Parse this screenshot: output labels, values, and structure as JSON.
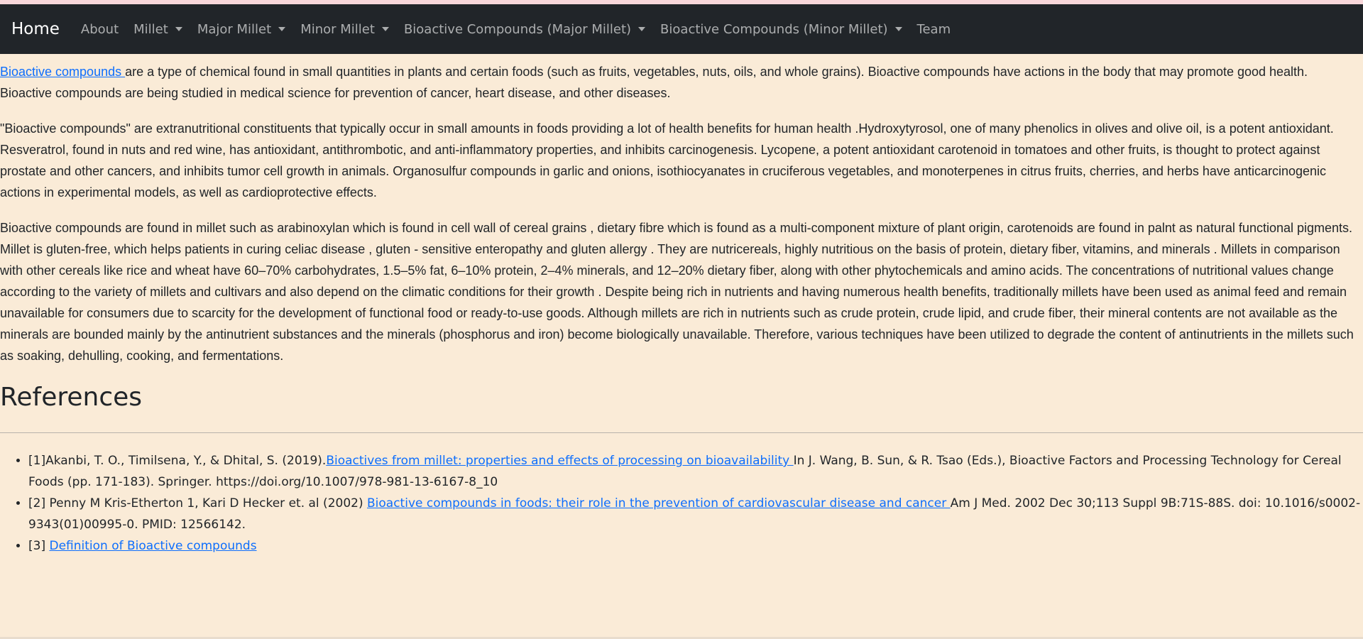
{
  "navbar": {
    "brand": "Home",
    "items": [
      {
        "label": "About",
        "dropdown": false
      },
      {
        "label": "Millet",
        "dropdown": true
      },
      {
        "label": "Major Millet",
        "dropdown": true
      },
      {
        "label": "Minor Millet",
        "dropdown": true
      },
      {
        "label": "Bioactive Compounds (Major Millet)",
        "dropdown": true
      },
      {
        "label": "Bioactive Compounds (Minor Millet)",
        "dropdown": true
      },
      {
        "label": "Team",
        "dropdown": false
      }
    ]
  },
  "content": {
    "p1_link": "Bioactive compounds ",
    "p1_text": "are a type of chemical found in small quantities in plants and certain foods (such as fruits, vegetables, nuts, oils, and whole grains). Bioactive compounds have actions in the body that may promote good health. Bioactive compounds are being studied in medical science for prevention of cancer, heart disease, and other diseases.",
    "p2_text": "\"Bioactive compounds\" are extranutritional constituents that typically occur in small amounts in foods providing a lot of health benefits for human health .Hydroxytyrosol, one of many phenolics in olives and olive oil, is a potent antioxidant. Resveratrol, found in nuts and red wine, has antioxidant, antithrombotic, and anti-inflammatory properties, and inhibits carcinogenesis. Lycopene, a potent antioxidant carotenoid in tomatoes and other fruits, is thought to protect against prostate and other cancers, and inhibits tumor cell growth in animals. Organosulfur compounds in garlic and onions, isothiocyanates in cruciferous vegetables, and monoterpenes in citrus fruits, cherries, and herbs have anticarcinogenic actions in experimental models, as well as cardioprotective effects.",
    "p3_text": "Bioactive compounds are found in millet such as arabinoxylan which is found in cell wall of cereal grains , dietary fibre which is found as a multi-component mixture of plant origin, carotenoids are found in palnt as natural functional pigments. Millet is gluten-free, which helps patients in curing celiac disease , gluten - sensitive enteropathy and gluten allergy . They are nutricereals, highly nutritious on the basis of protein, dietary fiber, vitamins, and minerals . Millets in comparison with other cereals like rice and wheat have 60–70% carbohydrates, 1.5–5% fat, 6–10% protein, 2–4% minerals, and 12–20% dietary fiber, along with other phytochemicals and amino acids. The concentrations of nutritional values change according to the variety of millets and cultivars and also depend on the climatic conditions for their growth . Despite being rich in nutrients and having numerous health benefits, traditionally millets have been used as animal feed and remain unavailable for consumers due to scarcity for the development of functional food or ready-to-use goods. Although millets are rich in nutrients such as crude protein, crude lipid, and crude fiber, their mineral contents are not available as the minerals are bounded mainly by the antinutrient substances and the minerals (phosphorus and iron) become biologically unavailable. Therefore, various techniques have been utilized to degrade the content of antinutrients in the millets such as soaking, dehulling, cooking, and fermentations."
  },
  "references": {
    "title": "References",
    "items": [
      {
        "prefix": "[1]Akanbi, T. O., Timilsena, Y., & Dhital, S. (2019).",
        "link": "Bioactives from millet: properties and effects of processing on bioavailability ",
        "suffix": "In J. Wang, B. Sun, & R. Tsao (Eds.), Bioactive Factors and Processing Technology for Cereal Foods (pp. 171-183). Springer. https://doi.org/10.1007/978-981-13-6167-8_10"
      },
      {
        "prefix": "[2] Penny M Kris-Etherton 1, Kari D Hecker et. al (2002) ",
        "link": "Bioactive compounds in foods: their role in the prevention of cardiovascular disease and cancer ",
        "suffix": "Am J Med. 2002 Dec 30;113 Suppl 9B:71S-88S. doi: 10.1016/s0002-9343(01)00995-0. PMID: 12566142."
      },
      {
        "prefix": "[3] ",
        "link": "Definition of Bioactive compounds",
        "suffix": ""
      }
    ]
  },
  "colors": {
    "background": "#faebd7",
    "navbar": "#212529",
    "link": "#0d6efd"
  }
}
